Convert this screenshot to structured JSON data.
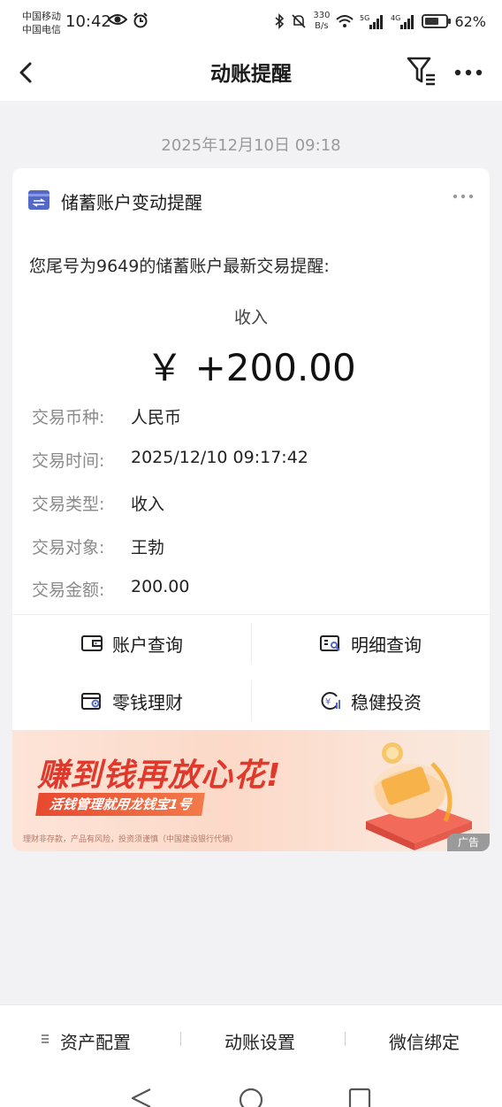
{
  "status_bar": {
    "carrier_1": "中国移动",
    "carrier_2": "中国电信",
    "time": "10:42",
    "net_speed_value": "330",
    "net_speed_unit": "B/s",
    "battery": "62%",
    "icons": [
      "eye-icon",
      "alarm-icon",
      "bluetooth-icon",
      "mute-icon",
      "wifi-icon",
      "signal-5g-icon",
      "signal-4g-icon",
      "battery-icon"
    ]
  },
  "nav": {
    "title": "动账提醒",
    "icons": [
      "back-arrow-icon",
      "filter-icon",
      "more-icon"
    ]
  },
  "message": {
    "date": "2025年12月10日 09:18",
    "card_title": "储蓄账户变动提醒",
    "intro": "您尾号为9649的储蓄账户最新交易提醒:",
    "type_label": "收入",
    "amount": "￥ +200.00",
    "details": [
      {
        "key": "交易币种:",
        "value": "人民币"
      },
      {
        "key": "交易时间:",
        "value": "2025/12/10 09:17:42"
      },
      {
        "key": "交易类型:",
        "value": "收入"
      },
      {
        "key": "交易对象:",
        "value": "王勃"
      },
      {
        "key": "交易金额:",
        "value": "200.00"
      }
    ],
    "actions": [
      {
        "label": "账户查询",
        "icon": "wallet-icon"
      },
      {
        "label": "明细查询",
        "icon": "detail-search-icon"
      },
      {
        "label": "零钱理财",
        "icon": "piggy-wallet-icon"
      },
      {
        "label": "稳健投资",
        "icon": "yuan-chart-icon"
      }
    ]
  },
  "ad": {
    "headline": "赚到钱再放心花!",
    "sub": "活钱管理就用龙钱宝1号",
    "disclaimer": "理财非存款，产品有风险，投资须谨慎（中国建设银行代销）",
    "tag": "广告"
  },
  "bottom_bar": {
    "items": [
      "资产配置",
      "动账设置",
      "微信绑定"
    ]
  },
  "colors": {
    "accent": "#5468c8",
    "ad_red": "#e0392b",
    "background": "#f2f2f4"
  }
}
